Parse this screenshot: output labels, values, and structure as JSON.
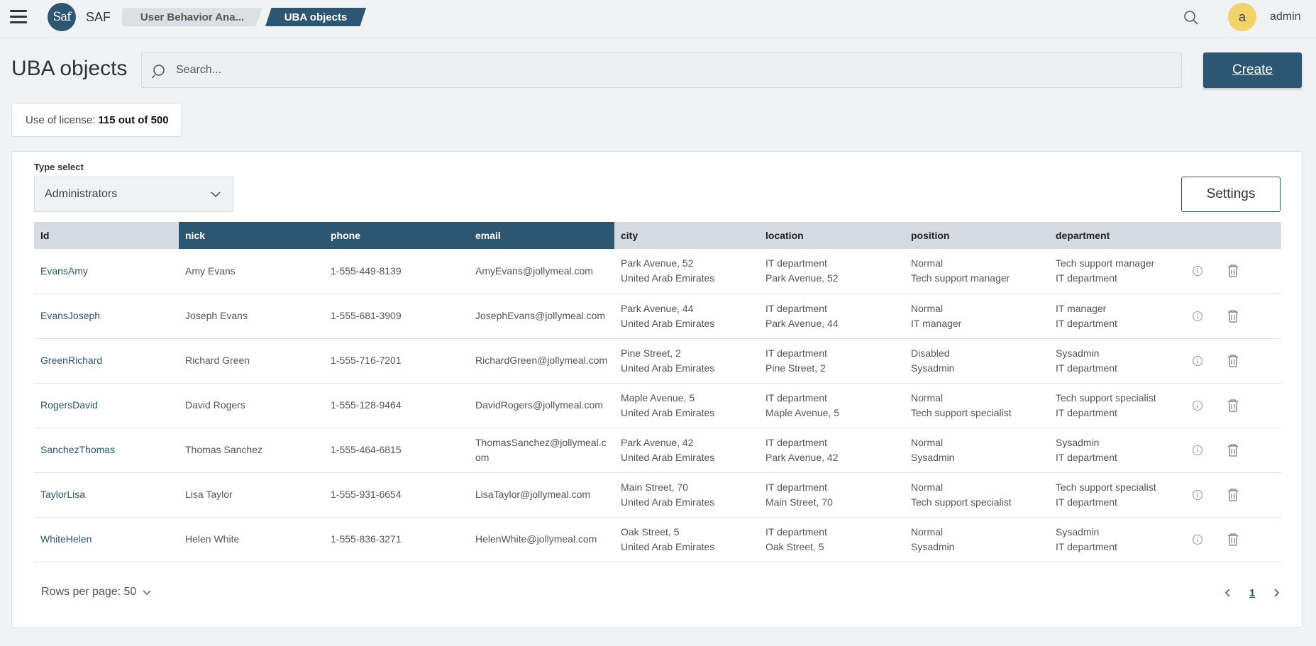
{
  "app": {
    "logo_text": "Saf",
    "name": "SAF"
  },
  "breadcrumbs": [
    "User Behavior Ana...",
    "UBA objects"
  ],
  "user": {
    "initial": "a",
    "name": "admin"
  },
  "page": {
    "title": "UBA objects",
    "search_placeholder": "Search...",
    "create_label": "Create"
  },
  "license": {
    "label": "Use of license:",
    "value": "115 out of 500"
  },
  "type_select": {
    "label": "Type select",
    "value": "Administrators"
  },
  "settings_label": "Settings",
  "table": {
    "columns": [
      "Id",
      "nick",
      "phone",
      "email",
      "city",
      "location",
      "position",
      "department"
    ],
    "highlighted_columns": [
      "nick",
      "phone",
      "email"
    ],
    "rows": [
      {
        "id": "EvansAmy",
        "nick": "Amy Evans",
        "phone": "1-555-449-8139",
        "email": "AmyEvans@jollymeal.com",
        "city": [
          "Park Avenue, 52",
          "United Arab Emirates"
        ],
        "location": [
          "IT department",
          "Park Avenue, 52"
        ],
        "position": [
          "Normal",
          "Tech support manager"
        ],
        "department": [
          "Tech support manager",
          "IT department"
        ]
      },
      {
        "id": "EvansJoseph",
        "nick": "Joseph Evans",
        "phone": "1-555-681-3909",
        "email": "JosephEvans@jollymeal.com",
        "city": [
          "Park Avenue, 44",
          "United Arab Emirates"
        ],
        "location": [
          "IT department",
          "Park Avenue, 44"
        ],
        "position": [
          "Normal",
          "IT manager"
        ],
        "department": [
          "IT manager",
          "IT department"
        ]
      },
      {
        "id": "GreenRichard",
        "nick": "Richard Green",
        "phone": "1-555-716-7201",
        "email": "RichardGreen@jollymeal.com",
        "city": [
          "Pine Street, 2",
          "United Arab Emirates"
        ],
        "location": [
          "IT department",
          "Pine Street, 2"
        ],
        "position": [
          "Disabled",
          "Sysadmin"
        ],
        "department": [
          "Sysadmin",
          "IT department"
        ]
      },
      {
        "id": "RogersDavid",
        "nick": "David Rogers",
        "phone": "1-555-128-9464",
        "email": "DavidRogers@jollymeal.com",
        "city": [
          "Maple Avenue, 5",
          "United Arab Emirates"
        ],
        "location": [
          "IT department",
          "Maple Avenue, 5"
        ],
        "position": [
          "Normal",
          "Tech support specialist"
        ],
        "department": [
          "Tech support specialist",
          "IT department"
        ]
      },
      {
        "id": "SanchezThomas",
        "nick": "Thomas Sanchez",
        "phone": "1-555-464-6815",
        "email": "ThomasSanchez@jollymeal.com",
        "city": [
          "Park Avenue, 42",
          "United Arab Emirates"
        ],
        "location": [
          "IT department",
          "Park Avenue, 42"
        ],
        "position": [
          "Normal",
          "Sysadmin"
        ],
        "department": [
          "Sysadmin",
          "IT department"
        ]
      },
      {
        "id": "TaylorLisa",
        "nick": "Lisa Taylor",
        "phone": "1-555-931-6654",
        "email": "LisaTaylor@jollymeal.com",
        "city": [
          "Main Street, 70",
          "United Arab Emirates"
        ],
        "location": [
          "IT department",
          "Main Street, 70"
        ],
        "position": [
          "Normal",
          "Tech support specialist"
        ],
        "department": [
          "Tech support specialist",
          "IT department"
        ]
      },
      {
        "id": "WhiteHelen",
        "nick": "Helen White",
        "phone": "1-555-836-3271",
        "email": "HelenWhite@jollymeal.com",
        "city": [
          "Oak Street, 5",
          "United Arab Emirates"
        ],
        "location": [
          "IT department",
          "Oak Street, 5"
        ],
        "position": [
          "Normal",
          "Sysadmin"
        ],
        "department": [
          "Sysadmin",
          "IT department"
        ]
      }
    ],
    "row_actions": [
      "info-icon",
      "trash-icon"
    ]
  },
  "pagination": {
    "rows_per_page_label": "Rows per page: 50",
    "current_page": "1"
  },
  "colors": {
    "primary": "#2c5672",
    "avatar": "#f2d36a",
    "header": "#d6dbe3"
  }
}
